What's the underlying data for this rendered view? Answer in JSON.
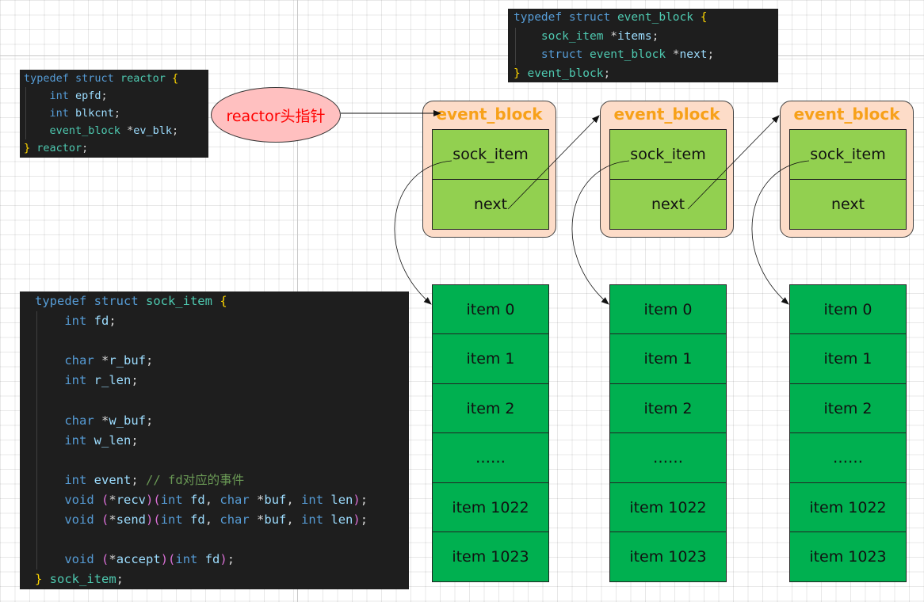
{
  "code": {
    "reactor": [
      [
        [
          "kw",
          "typedef "
        ],
        [
          "kw",
          "struct "
        ],
        [
          "ty",
          "reactor "
        ],
        [
          "br",
          "{"
        ]
      ],
      [
        [
          "tx",
          "    "
        ],
        [
          "kw",
          "int "
        ],
        [
          "va",
          "epfd"
        ],
        [
          "tx",
          ";"
        ]
      ],
      [
        [
          "tx",
          "    "
        ],
        [
          "kw",
          "int "
        ],
        [
          "va",
          "blkcnt"
        ],
        [
          "tx",
          ";"
        ]
      ],
      [
        [
          "tx",
          "    "
        ],
        [
          "ty",
          "event_block "
        ],
        [
          "tx",
          "*"
        ],
        [
          "va",
          "ev_blk"
        ],
        [
          "tx",
          ";"
        ]
      ],
      [
        [
          "br",
          "} "
        ],
        [
          "ty",
          "reactor"
        ],
        [
          "tx",
          ";"
        ]
      ]
    ],
    "event_block": [
      [
        [
          "kw",
          "typedef "
        ],
        [
          "kw",
          "struct "
        ],
        [
          "ty",
          "event_block "
        ],
        [
          "br",
          "{"
        ]
      ],
      [
        [
          "tx",
          "    "
        ],
        [
          "ty",
          "sock_item "
        ],
        [
          "tx",
          "*"
        ],
        [
          "va",
          "items"
        ],
        [
          "tx",
          ";"
        ]
      ],
      [
        [
          "tx",
          "    "
        ],
        [
          "kw",
          "struct "
        ],
        [
          "ty",
          "event_block "
        ],
        [
          "tx",
          "*"
        ],
        [
          "va",
          "next"
        ],
        [
          "tx",
          ";"
        ]
      ],
      [
        [
          "br",
          "} "
        ],
        [
          "ty",
          "event_block"
        ],
        [
          "tx",
          ";"
        ]
      ]
    ],
    "sock_item": [
      [
        [
          "kw",
          "typedef "
        ],
        [
          "kw",
          "struct "
        ],
        [
          "ty",
          "sock_item "
        ],
        [
          "br",
          "{"
        ]
      ],
      [
        [
          "tx",
          "    "
        ],
        [
          "kw",
          "int "
        ],
        [
          "va",
          "fd"
        ],
        [
          "tx",
          ";"
        ]
      ],
      [
        [
          "tx",
          " "
        ]
      ],
      [
        [
          "tx",
          "    "
        ],
        [
          "kw",
          "char "
        ],
        [
          "tx",
          "*"
        ],
        [
          "va",
          "r_buf"
        ],
        [
          "tx",
          ";"
        ]
      ],
      [
        [
          "tx",
          "    "
        ],
        [
          "kw",
          "int "
        ],
        [
          "va",
          "r_len"
        ],
        [
          "tx",
          ";"
        ]
      ],
      [
        [
          "tx",
          " "
        ]
      ],
      [
        [
          "tx",
          "    "
        ],
        [
          "kw",
          "char "
        ],
        [
          "tx",
          "*"
        ],
        [
          "va",
          "w_buf"
        ],
        [
          "tx",
          ";"
        ]
      ],
      [
        [
          "tx",
          "    "
        ],
        [
          "kw",
          "int "
        ],
        [
          "va",
          "w_len"
        ],
        [
          "tx",
          ";"
        ]
      ],
      [
        [
          "tx",
          " "
        ]
      ],
      [
        [
          "tx",
          "    "
        ],
        [
          "kw",
          "int "
        ],
        [
          "va",
          "event"
        ],
        [
          "tx",
          "; "
        ],
        [
          "cm",
          "// fd对应的事件"
        ]
      ],
      [
        [
          "tx",
          "    "
        ],
        [
          "kw",
          "void "
        ],
        [
          "pn",
          "("
        ],
        [
          "tx",
          "*"
        ],
        [
          "va",
          "recv"
        ],
        [
          "pn",
          ")("
        ],
        [
          "kw",
          "int "
        ],
        [
          "va",
          "fd"
        ],
        [
          "tx",
          ", "
        ],
        [
          "kw",
          "char "
        ],
        [
          "tx",
          "*"
        ],
        [
          "va",
          "buf"
        ],
        [
          "tx",
          ", "
        ],
        [
          "kw",
          "int "
        ],
        [
          "va",
          "len"
        ],
        [
          "pn",
          ")"
        ],
        [
          "tx",
          ";"
        ]
      ],
      [
        [
          "tx",
          "    "
        ],
        [
          "kw",
          "void "
        ],
        [
          "pn",
          "("
        ],
        [
          "tx",
          "*"
        ],
        [
          "va",
          "send"
        ],
        [
          "pn",
          ")("
        ],
        [
          "kw",
          "int "
        ],
        [
          "va",
          "fd"
        ],
        [
          "tx",
          ", "
        ],
        [
          "kw",
          "char "
        ],
        [
          "tx",
          "*"
        ],
        [
          "va",
          "buf"
        ],
        [
          "tx",
          ", "
        ],
        [
          "kw",
          "int "
        ],
        [
          "va",
          "len"
        ],
        [
          "pn",
          ")"
        ],
        [
          "tx",
          ";"
        ]
      ],
      [
        [
          "tx",
          " "
        ]
      ],
      [
        [
          "tx",
          "    "
        ],
        [
          "kw",
          "void "
        ],
        [
          "pn",
          "("
        ],
        [
          "tx",
          "*"
        ],
        [
          "va",
          "accept"
        ],
        [
          "pn",
          ")("
        ],
        [
          "kw",
          "int "
        ],
        [
          "va",
          "fd"
        ],
        [
          "pn",
          ")"
        ],
        [
          "tx",
          ";"
        ]
      ],
      [
        [
          "br",
          "} "
        ],
        [
          "ty",
          "sock_item"
        ],
        [
          "tx",
          ";"
        ]
      ]
    ]
  },
  "head_pointer_label": "reactor头指针",
  "blocks": [
    {
      "title": "event_block",
      "field1": "sock_item",
      "field2": "next"
    },
    {
      "title": "event_block",
      "field1": "sock_item",
      "field2": "next"
    },
    {
      "title": "event_block",
      "field1": "sock_item",
      "field2": "next"
    }
  ],
  "items": [
    "item 0",
    "item 1",
    "item 2",
    "……",
    "item 1022",
    "item 1023"
  ],
  "colors": {
    "block_bg": "#fddcc8",
    "block_title": "#f7a11a",
    "field_fill": "#92d050",
    "item_fill": "#00b050",
    "ellipse_fill": "#ffc0c0",
    "ellipse_text": "#ff0000",
    "code_bg": "#1e1e1e"
  }
}
